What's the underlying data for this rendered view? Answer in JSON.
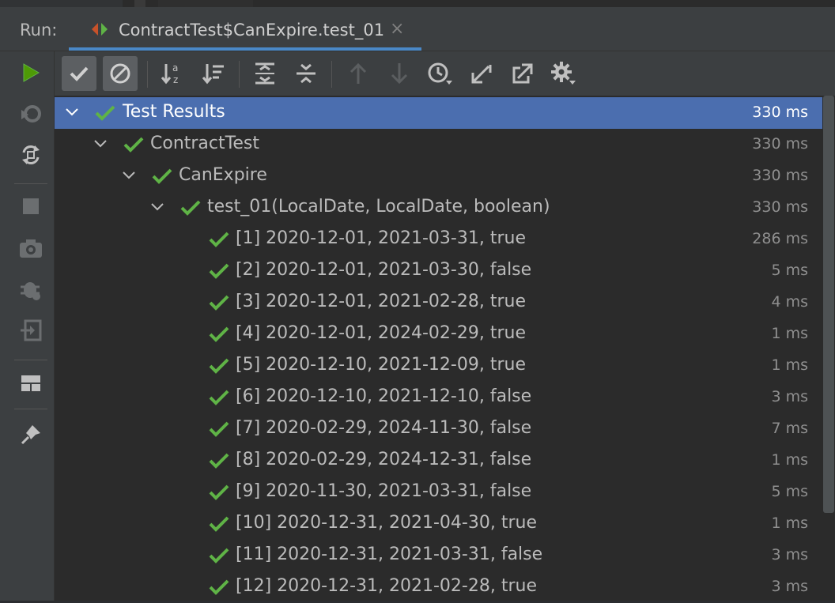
{
  "run_label": "Run:",
  "tab": {
    "title": "ContractTest$CanExpire.test_01",
    "close": "×"
  },
  "left_toolbar": [
    {
      "name": "rerun-icon",
      "color": "#4e9a06"
    },
    {
      "name": "rerun-failed-icon"
    },
    {
      "name": "toggle-auto-test-icon"
    },
    {
      "name": "stop-icon"
    },
    {
      "name": "camera-icon"
    },
    {
      "name": "debug-icon"
    },
    {
      "name": "import-tests-icon"
    },
    {
      "name": "layout-icon"
    },
    {
      "name": "pin-icon"
    }
  ],
  "toolbar": [
    "show-passed-icon",
    "show-ignored-icon",
    "sort-alphabetically-icon",
    "sort-by-duration-icon",
    "expand-all-icon",
    "collapse-all-icon",
    "previous-failed-icon",
    "next-failed-icon",
    "test-history-icon",
    "import-icon",
    "export-icon",
    "settings-icon"
  ],
  "colors": {
    "pass": "#5fb346",
    "selection": "#4b6eaf"
  },
  "tree": [
    {
      "label": "Test Results",
      "duration": "330 ms"
    },
    {
      "label": "ContractTest",
      "duration": "330 ms"
    },
    {
      "label": "CanExpire",
      "duration": "330 ms"
    },
    {
      "label": "test_01(LocalDate, LocalDate, boolean)",
      "duration": "330 ms"
    },
    {
      "label": "[1] 2020-12-01, 2021-03-31, true",
      "duration": "286 ms"
    },
    {
      "label": "[2] 2020-12-01, 2021-03-30, false",
      "duration": "5 ms"
    },
    {
      "label": "[3] 2020-12-01, 2021-02-28, true",
      "duration": "4 ms"
    },
    {
      "label": "[4] 2020-12-01, 2024-02-29, true",
      "duration": "1 ms"
    },
    {
      "label": "[5] 2020-12-10, 2021-12-09, true",
      "duration": "1 ms"
    },
    {
      "label": "[6] 2020-12-10, 2021-12-10, false",
      "duration": "3 ms"
    },
    {
      "label": "[7] 2020-02-29, 2024-11-30, false",
      "duration": "7 ms"
    },
    {
      "label": "[8] 2020-02-29, 2024-12-31, false",
      "duration": "1 ms"
    },
    {
      "label": "[9] 2020-11-30, 2021-03-31, false",
      "duration": "5 ms"
    },
    {
      "label": "[10] 2020-12-31, 2021-04-30, true",
      "duration": "1 ms"
    },
    {
      "label": "[11] 2020-12-31, 2021-03-31, false",
      "duration": "3 ms"
    },
    {
      "label": "[12] 2020-12-31, 2021-02-28, true",
      "duration": "3 ms"
    }
  ]
}
